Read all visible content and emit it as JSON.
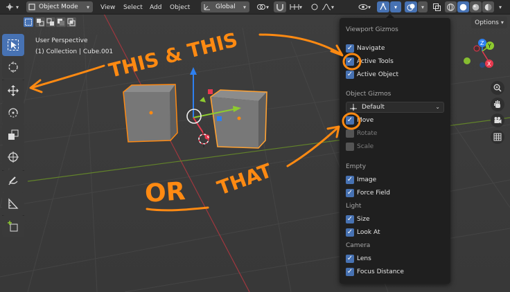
{
  "header": {
    "mode_label": "Object Mode",
    "menus": [
      "View",
      "Select",
      "Add",
      "Object"
    ],
    "orientation_label": "Global",
    "options_label": "Options"
  },
  "viewport": {
    "perspective_label": "User Perspective",
    "collection_label": "(1) Collection | Cube.001"
  },
  "nav_gizmo": {
    "z": "Z",
    "y": "Y",
    "x": "X"
  },
  "gizmo_panel": {
    "viewport_header": "Viewport Gizmos",
    "viewport_items": [
      {
        "label": "Navigate",
        "checked": true
      },
      {
        "label": "Active Tools",
        "checked": true
      },
      {
        "label": "Active Object",
        "checked": true
      }
    ],
    "object_header": "Object Gizmos",
    "object_select": "Default",
    "object_items": [
      {
        "label": "Move",
        "checked": true
      },
      {
        "label": "Rotate",
        "checked": false
      },
      {
        "label": "Scale",
        "checked": false
      }
    ],
    "empty_header": "Empty",
    "empty_items": [
      {
        "label": "Image",
        "checked": true
      },
      {
        "label": "Force Field",
        "checked": true
      }
    ],
    "light_header": "Light",
    "light_items": [
      {
        "label": "Size",
        "checked": true
      },
      {
        "label": "Look At",
        "checked": true
      }
    ],
    "camera_header": "Camera",
    "camera_items": [
      {
        "label": "Lens",
        "checked": true
      },
      {
        "label": "Focus Distance",
        "checked": true
      }
    ]
  },
  "annotations": {
    "text1": "THIS & THIS",
    "text2": "OR",
    "text3": "THAT",
    "color": "#ff8a12"
  },
  "colors": {
    "accent": "#4772b3",
    "selection_outline": "#ff8a12",
    "axis_x": "#e8394f",
    "axis_y": "#8ecb2f",
    "axis_z": "#2e80f0"
  }
}
